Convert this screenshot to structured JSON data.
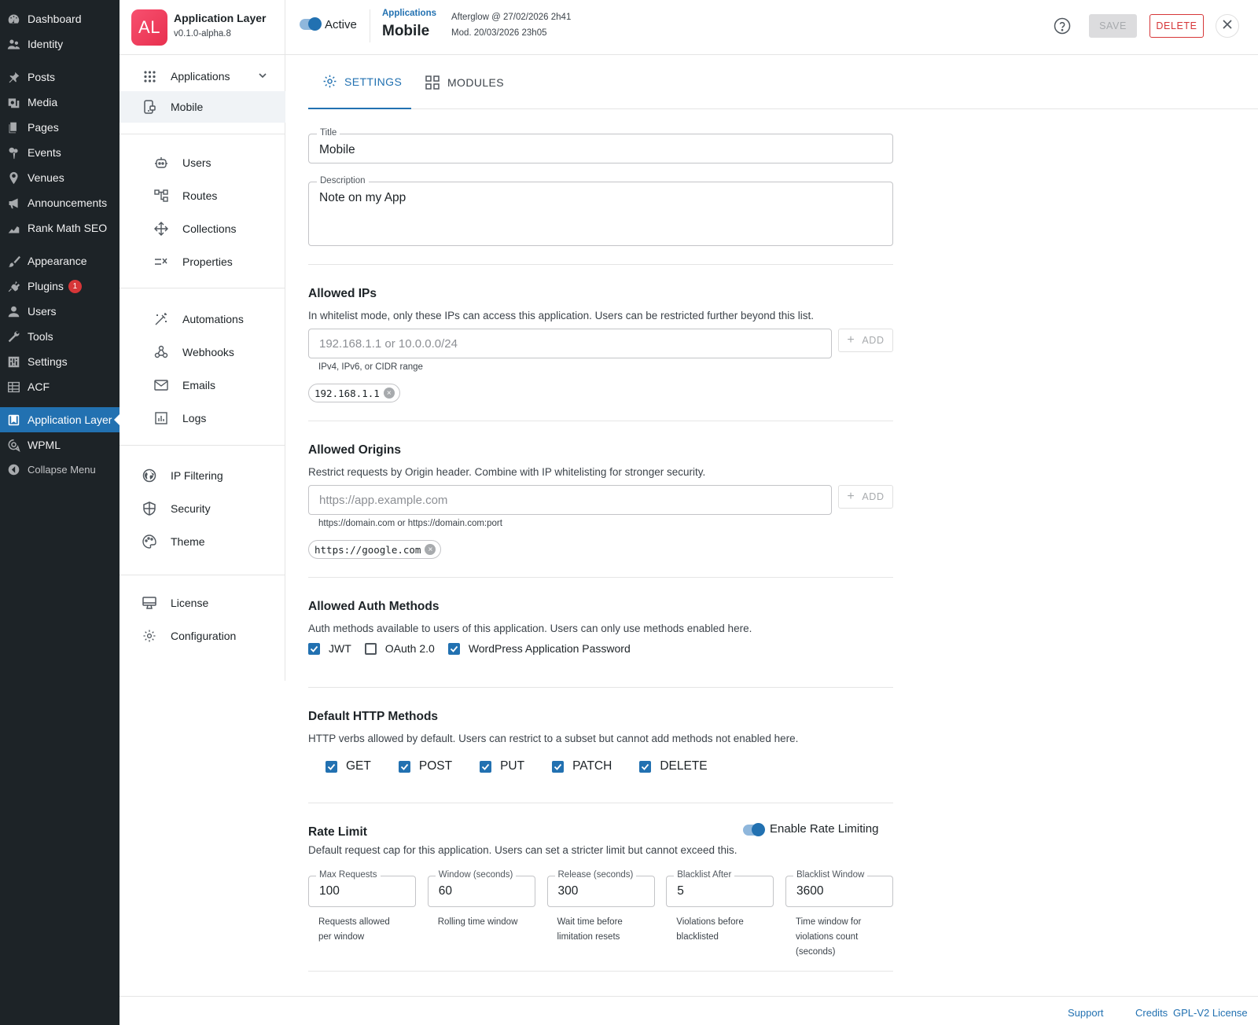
{
  "wp_menu": [
    {
      "label": "Dashboard",
      "icon": "dashboard-icon"
    },
    {
      "label": "Identity",
      "icon": "users-icon"
    },
    {
      "label": "Posts",
      "icon": "pin-icon"
    },
    {
      "label": "Media",
      "icon": "media-icon"
    },
    {
      "label": "Pages",
      "icon": "pages-icon"
    },
    {
      "label": "Events",
      "icon": "events-icon"
    },
    {
      "label": "Venues",
      "icon": "location-icon"
    },
    {
      "label": "Announcements",
      "icon": "megaphone-icon"
    },
    {
      "label": "Rank Math SEO",
      "icon": "chart-icon"
    },
    {
      "label": "Appearance",
      "icon": "brush-icon"
    },
    {
      "label": "Plugins",
      "icon": "plugin-icon",
      "badge": "1"
    },
    {
      "label": "Users",
      "icon": "user-icon"
    },
    {
      "label": "Tools",
      "icon": "wrench-icon"
    },
    {
      "label": "Settings",
      "icon": "settings-icon"
    },
    {
      "label": "ACF",
      "icon": "acf-icon"
    },
    {
      "label": "Application Layer",
      "icon": "app-layer-icon",
      "active": true
    },
    {
      "label": "WPML",
      "icon": "wpml-icon"
    },
    {
      "label": "Collapse Menu",
      "icon": "collapse-icon"
    }
  ],
  "app": {
    "logo_text": "AL",
    "name": "Application Layer",
    "version": "v0.1.0-alpha.8"
  },
  "nav": {
    "applications": "Applications",
    "mobile": "Mobile",
    "users": "Users",
    "routes": "Routes",
    "collections": "Collections",
    "properties": "Properties",
    "automations": "Automations",
    "webhooks": "Webhooks",
    "emails": "Emails",
    "logs": "Logs",
    "ip_filtering": "IP Filtering",
    "security": "Security",
    "theme": "Theme",
    "license": "License",
    "configuration": "Configuration"
  },
  "header": {
    "active_label": "Active",
    "active": true,
    "breadcrumb": "Applications",
    "title": "Mobile",
    "created": "Afterglow @ 27/02/2026 2h41",
    "modified": "Mod. 20/03/2026 23h05",
    "save": "SAVE",
    "delete": "DELETE"
  },
  "tabs": {
    "settings": "SETTINGS",
    "modules": "MODULES"
  },
  "form": {
    "title_legend": "Title",
    "title_value": "Mobile",
    "description_legend": "Description",
    "description_value": "Note on my App"
  },
  "allowed_ips": {
    "title": "Allowed IPs",
    "description": "In whitelist mode, only these IPs can access this application. Users can be restricted further beyond this list.",
    "placeholder": "192.168.1.1 or 10.0.0.0/24",
    "add": "ADD",
    "hint": "IPv4, IPv6, or CIDR range",
    "chips": [
      "192.168.1.1"
    ]
  },
  "allowed_origins": {
    "title": "Allowed Origins",
    "description": "Restrict requests by Origin header. Combine with IP whitelisting for stronger security.",
    "placeholder": "https://app.example.com",
    "add": "ADD",
    "hint": "https://domain.com or https://domain.com:port",
    "chips": [
      "https://google.com"
    ]
  },
  "auth_methods": {
    "title": "Allowed Auth Methods",
    "description": "Auth methods available to users of this application. Users can only use methods enabled here.",
    "options": [
      {
        "label": "JWT",
        "checked": true
      },
      {
        "label": "OAuth 2.0",
        "checked": false
      },
      {
        "label": "WordPress Application Password",
        "checked": true
      }
    ]
  },
  "http_methods": {
    "title": "Default HTTP Methods",
    "description": "HTTP verbs allowed by default. Users can restrict to a subset but cannot add methods not enabled here.",
    "options": [
      {
        "label": "GET",
        "checked": true
      },
      {
        "label": "POST",
        "checked": true
      },
      {
        "label": "PUT",
        "checked": true
      },
      {
        "label": "PATCH",
        "checked": true
      },
      {
        "label": "DELETE",
        "checked": true
      }
    ]
  },
  "rate_limit": {
    "title": "Rate Limit",
    "toggle_label": "Enable Rate Limiting",
    "enabled": true,
    "description": "Default request cap for this application. Users can set a stricter limit but cannot exceed this.",
    "fields": [
      {
        "legend": "Max Requests",
        "value": "100",
        "help": "Requests allowed per window"
      },
      {
        "legend": "Window (seconds)",
        "value": "60",
        "help": "Rolling time window"
      },
      {
        "legend": "Release (seconds)",
        "value": "300",
        "help": "Wait time before limitation resets"
      },
      {
        "legend": "Blacklist After",
        "value": "5",
        "help": "Violations before blacklisted"
      },
      {
        "legend": "Blacklist Window",
        "value": "3600",
        "help": "Time window for violations count (seconds)"
      }
    ]
  },
  "footer": {
    "support": "Support",
    "credits": "Credits",
    "license": "GPL-V2 License"
  },
  "colors": {
    "accent": "#2271b1",
    "danger": "#d63638",
    "sidebar_bg": "#1d2327",
    "logo_gradient": "#f7506f"
  }
}
